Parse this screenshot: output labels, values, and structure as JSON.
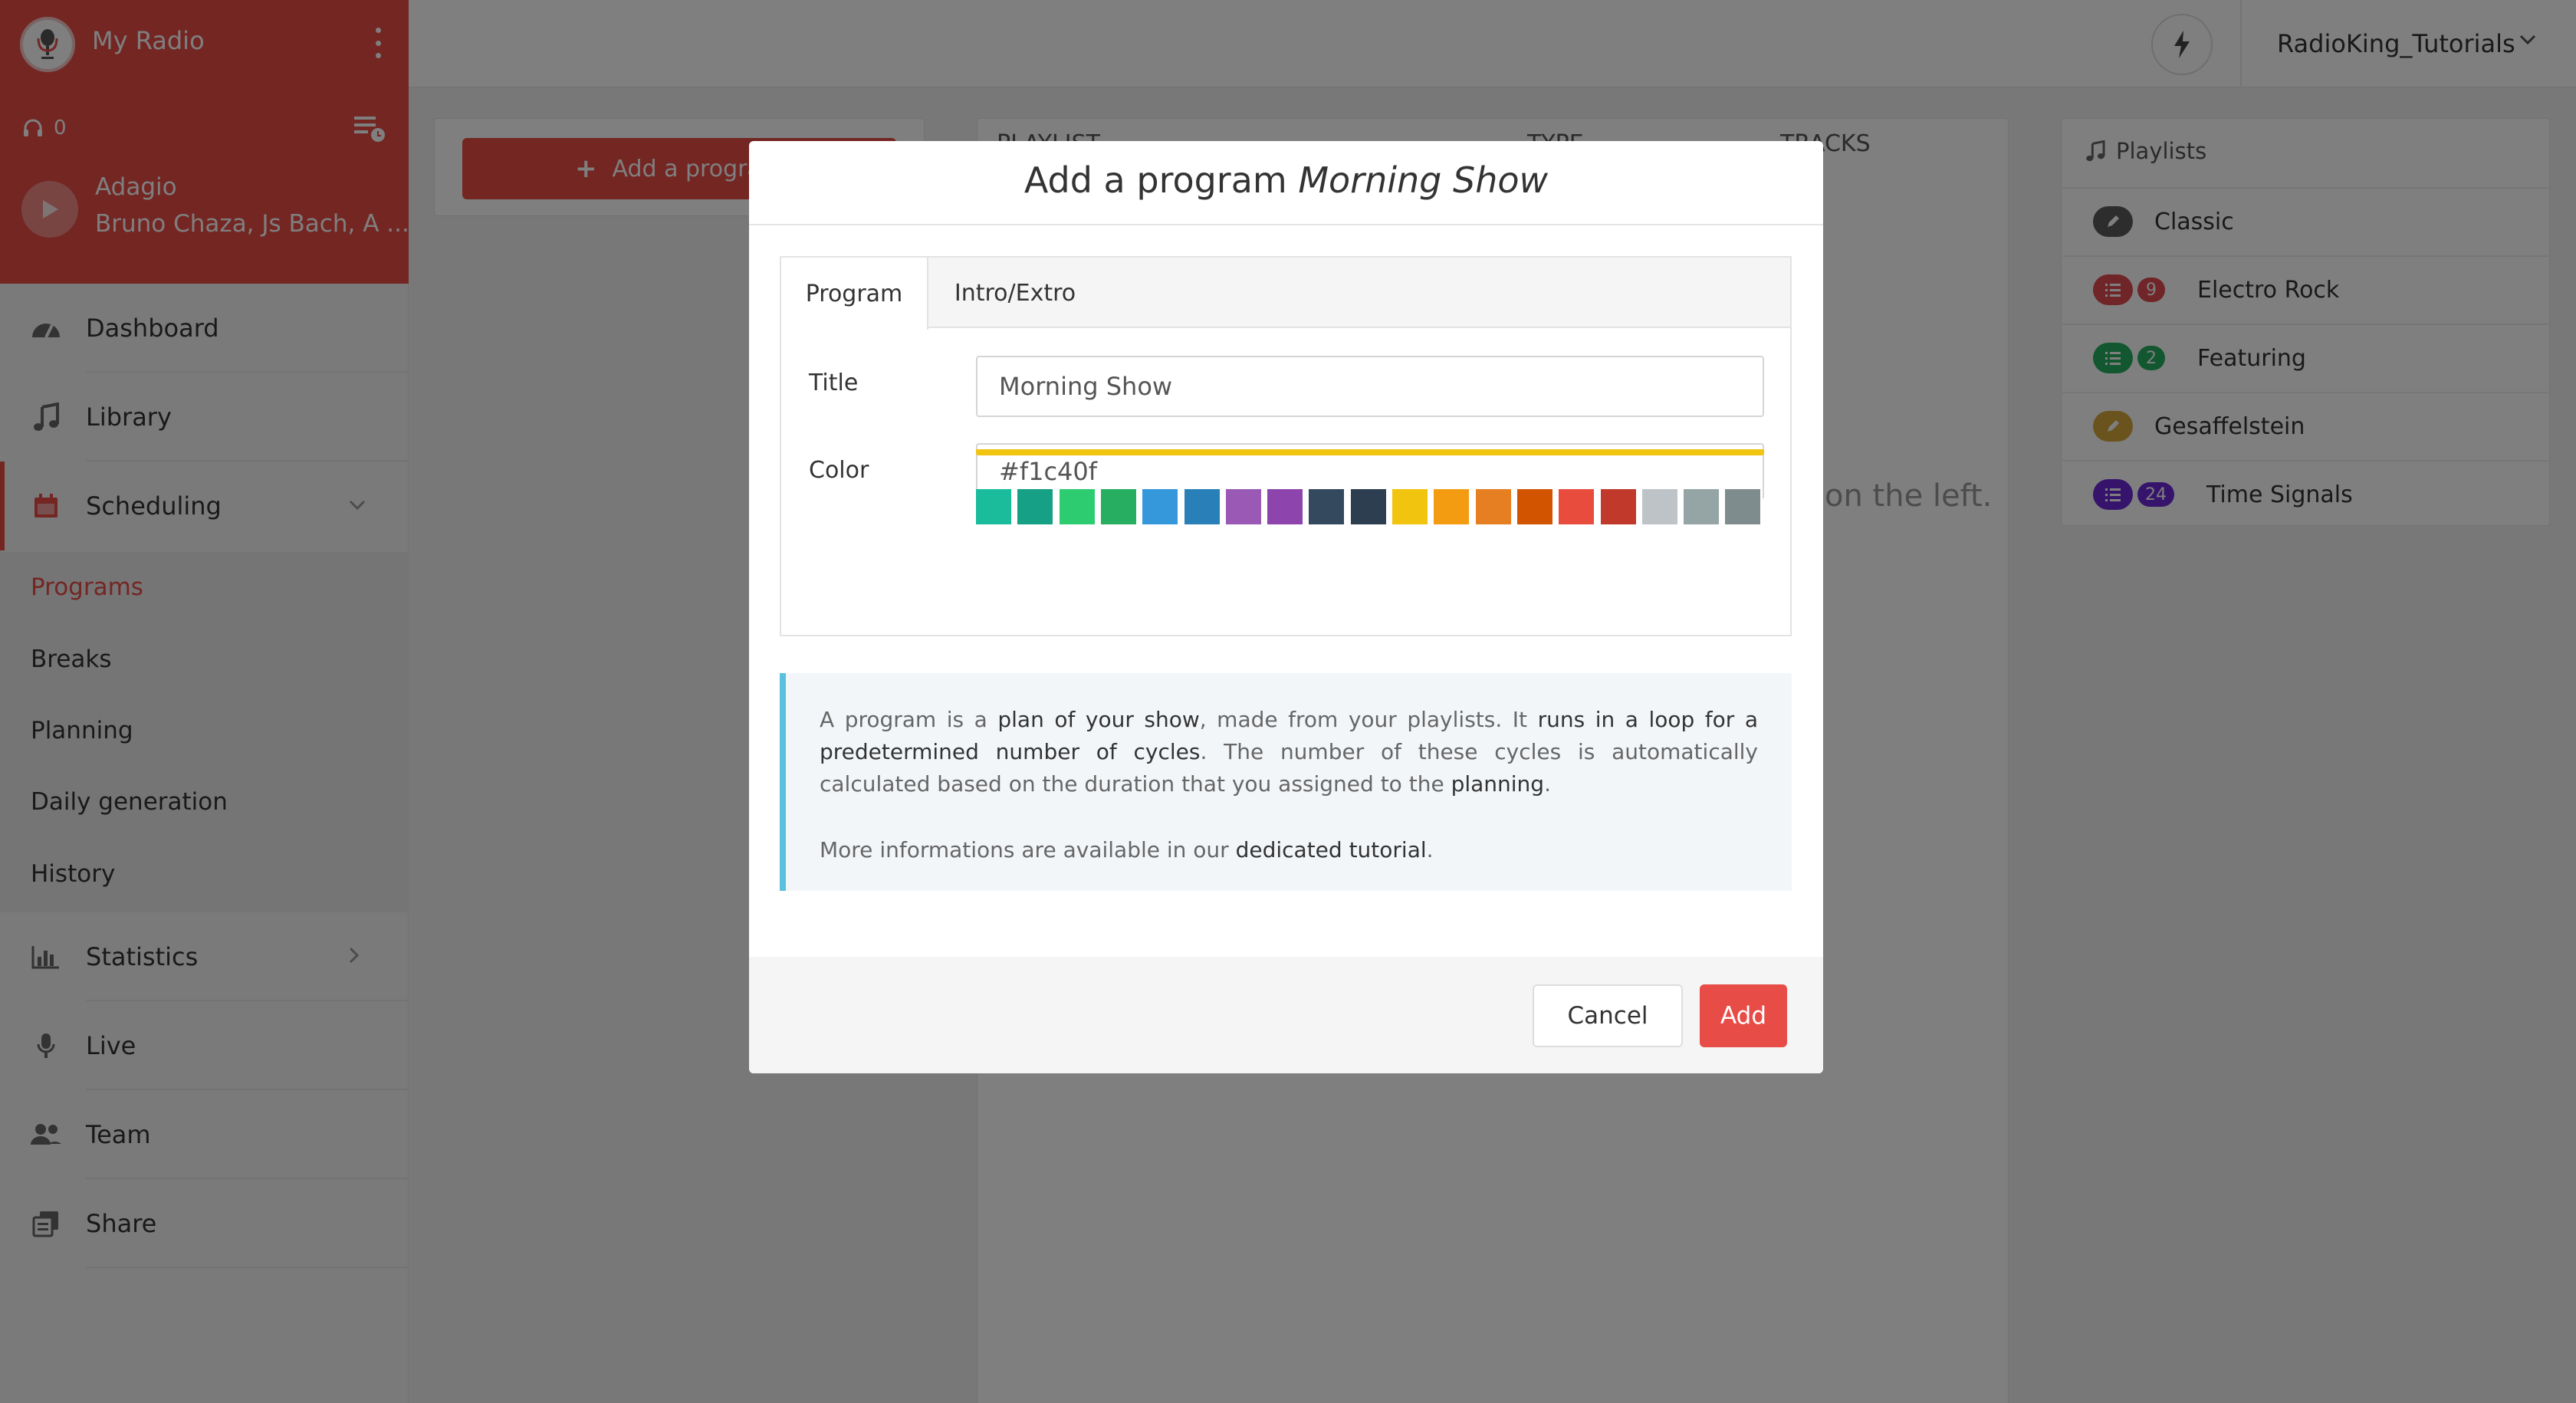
{
  "sidebar": {
    "radio_name": "My Radio",
    "listeners": "0",
    "now_playing": {
      "title": "Adagio",
      "artist": "Bruno Chaza, Js Bach, A ..."
    },
    "nav": {
      "dashboard": "Dashboard",
      "library": "Library",
      "scheduling": "Scheduling",
      "statistics": "Statistics",
      "live": "Live",
      "team": "Team",
      "share": "Share"
    },
    "submenu": {
      "programs": "Programs",
      "breaks": "Breaks",
      "planning": "Planning",
      "daily_generation": "Daily generation",
      "history": "History"
    }
  },
  "topbar": {
    "account": "RadioKing_Tutorials"
  },
  "main": {
    "add_button": "Add a program",
    "columns": {
      "playlist": "PLAYLIST",
      "type": "TYPE",
      "tracks": "TRACKS"
    },
    "hint": "on the left."
  },
  "playlists": {
    "title": "Playlists",
    "items": [
      {
        "name": "Classic",
        "count": "",
        "color": "#5a5a5a",
        "icon": "pencil-icon"
      },
      {
        "name": "Electro Rock",
        "count": "9",
        "color": "#e04a50",
        "icon": "list-icon"
      },
      {
        "name": "Featuring",
        "count": "2",
        "color": "#27ae60",
        "icon": "list-icon"
      },
      {
        "name": "Gesaffelstein",
        "count": "",
        "color": "#d4a63a",
        "icon": "pencil-icon"
      },
      {
        "name": "Time Signals",
        "count": "24",
        "color": "#6d28d9",
        "icon": "list-icon"
      }
    ]
  },
  "modal": {
    "title_prefix": "Add a program",
    "title_name": "Morning Show",
    "tabs": {
      "program": "Program",
      "intro_extro": "Intro/Extro"
    },
    "fields": {
      "title_label": "Title",
      "title_value": "Morning Show",
      "color_label": "Color",
      "color_value": "#f1c40f"
    },
    "swatches": [
      "#1abc9c",
      "#16a085",
      "#2ecc71",
      "#27ae60",
      "#3498db",
      "#2980b9",
      "#9b59b6",
      "#8e44ad",
      "#34495e",
      "#2c3e50",
      "#f1c40f",
      "#f39c12",
      "#e67e22",
      "#d35400",
      "#e74c3c",
      "#c0392b",
      "#bdc3c7",
      "#95a5a6",
      "#7f8c8d"
    ],
    "info": {
      "p1_a": "A program is a ",
      "p1_b": "plan of your show",
      "p1_c": ", made from your playlists. It ",
      "p1_d": "runs in a loop for a predetermined number of cycles",
      "p1_e": ". The number of these cycles is automatically calculated based on the duration that you assigned to the ",
      "p1_f": "planning",
      "p1_g": ".",
      "p2_a": "More informations are available in our ",
      "p2_b": "dedicated tutorial",
      "p2_c": "."
    },
    "cancel": "Cancel",
    "add": "Add"
  }
}
